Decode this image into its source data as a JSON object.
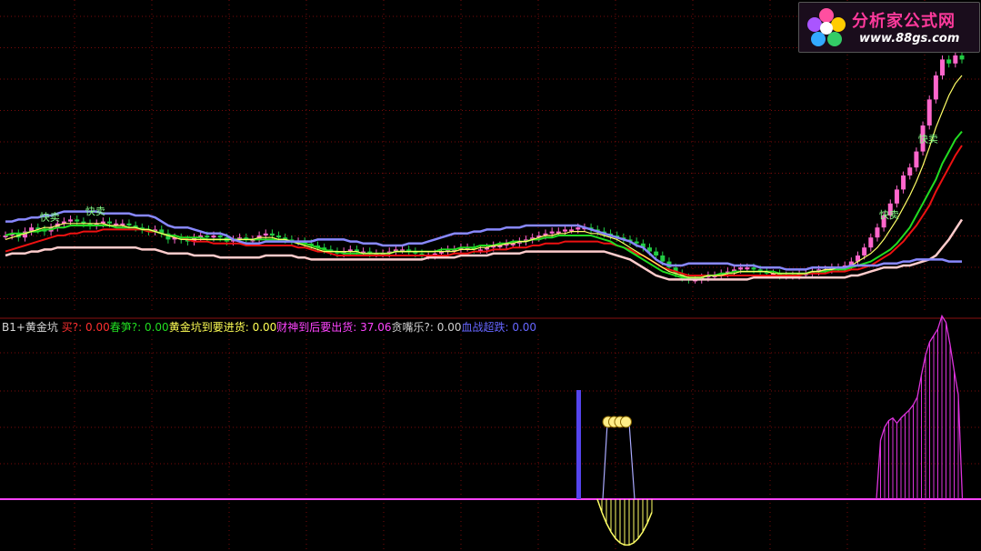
{
  "logo": {
    "text_cn": "分析家公式网",
    "url": "www.88gs.com",
    "icon": "flower-icon",
    "text_color": "#ff3a9c"
  },
  "indicator_header": {
    "name": "B1+黄金坑",
    "items": [
      {
        "label": "买?:",
        "value": "0.00",
        "color": "#ff3030"
      },
      {
        "label": "春笋?:",
        "value": "0.00",
        "color": "#22dd22"
      },
      {
        "label": "黄金坑到要进货:",
        "value": "0.00",
        "color": "#ffff55"
      },
      {
        "label": "财神到后要出货:",
        "value": "37.06",
        "color": "#ff44ff"
      },
      {
        "label": "贪嘴乐?:",
        "value": "0.00",
        "color": "#d0d0d0"
      },
      {
        "label": "血战超跌:",
        "value": "0.00",
        "color": "#6666ff"
      }
    ]
  },
  "annotations": [
    {
      "text": "快卖",
      "at": 12,
      "color": "#88ff88"
    },
    {
      "text": "快卖",
      "at": 28,
      "color": "#88ff88"
    },
    {
      "text": "快卖",
      "at": 315,
      "color": "#88ff88"
    },
    {
      "text": "快卖",
      "at": 328,
      "color": "#88ff88"
    }
  ],
  "chart_data": {
    "type": "line",
    "main_panel": {
      "price": [
        30,
        31,
        29,
        32,
        34,
        33,
        32,
        34,
        36,
        37,
        38,
        37,
        36,
        35,
        36,
        37,
        36,
        36,
        36,
        35,
        34,
        33,
        32,
        33,
        31,
        28,
        29,
        28,
        27,
        29,
        30,
        29,
        30,
        29,
        27,
        28,
        29,
        28,
        28,
        30,
        31,
        30,
        29,
        28,
        27,
        27,
        26,
        25,
        24,
        23,
        22,
        21,
        22,
        23,
        22,
        22,
        21,
        21,
        21,
        22,
        23,
        23,
        22,
        21,
        20,
        20,
        21,
        22,
        23,
        23,
        24,
        24,
        23,
        23,
        24,
        25,
        25,
        26,
        26,
        27,
        28,
        29,
        30,
        31,
        32,
        32,
        33,
        33,
        34,
        34,
        33,
        32,
        31,
        30,
        29,
        28,
        27,
        26,
        24,
        22,
        20,
        17,
        14,
        11,
        9,
        8,
        8,
        9,
        10,
        10,
        11,
        12,
        13,
        14,
        14,
        13,
        12,
        11,
        11,
        10,
        10,
        10,
        11,
        11,
        12,
        13,
        13,
        14,
        14,
        15,
        17,
        20,
        24,
        29,
        34,
        40,
        46,
        53,
        60,
        64,
        72,
        85,
        98,
        110,
        118,
        116,
        120,
        118
      ],
      "upper_band": [
        37,
        37,
        38,
        38,
        39,
        39,
        40,
        40,
        41,
        42,
        42,
        42,
        42,
        42,
        42,
        41,
        41,
        41,
        41,
        41,
        40,
        40,
        40,
        39,
        37,
        35,
        34,
        34,
        34,
        33,
        32,
        31,
        31,
        31,
        30,
        28,
        27,
        26,
        26,
        26,
        27,
        27,
        27,
        27,
        27,
        27,
        27,
        27,
        28,
        28,
        28,
        28,
        28,
        27,
        27,
        26,
        26,
        26,
        25,
        25,
        25,
        25,
        26,
        26,
        26,
        27,
        28,
        29,
        30,
        31,
        31,
        31,
        32,
        32,
        33,
        33,
        33,
        34,
        34,
        34,
        35,
        35,
        35,
        35,
        35,
        35,
        35,
        35,
        35,
        34,
        33,
        32,
        31,
        30,
        29,
        28,
        27,
        25,
        24,
        21,
        18,
        16,
        15,
        15,
        15,
        16,
        16,
        16,
        16,
        16,
        16,
        16,
        15,
        15,
        15,
        15,
        14,
        14,
        14,
        14,
        13,
        13,
        13,
        13,
        14,
        14,
        14,
        14,
        14,
        14,
        15,
        15,
        15,
        15,
        15,
        16,
        16,
        16,
        17,
        17,
        18,
        18,
        18,
        18,
        18,
        17,
        17,
        17
      ],
      "ma_green": [
        30,
        31,
        31,
        31,
        32,
        32,
        33,
        33,
        34,
        34,
        35,
        35,
        35,
        35,
        35,
        35,
        35,
        34,
        34,
        34,
        34,
        33,
        33,
        32,
        31,
        30,
        30,
        29,
        29,
        29,
        29,
        28,
        28,
        28,
        28,
        28,
        28,
        28,
        28,
        28,
        28,
        28,
        28,
        28,
        27,
        26,
        26,
        25,
        24,
        23,
        22,
        22,
        21,
        21,
        21,
        21,
        21,
        21,
        21,
        21,
        22,
        22,
        22,
        22,
        22,
        22,
        22,
        23,
        23,
        23,
        24,
        24,
        24,
        25,
        25,
        25,
        26,
        26,
        27,
        27,
        27,
        28,
        28,
        29,
        29,
        30,
        30,
        30,
        30,
        30,
        30,
        29,
        28,
        27,
        25,
        24,
        22,
        20,
        18,
        16,
        14,
        12,
        11,
        10,
        9,
        9,
        9,
        9,
        10,
        10,
        11,
        11,
        12,
        12,
        12,
        12,
        12,
        12,
        12,
        11,
        11,
        11,
        11,
        11,
        12,
        12,
        12,
        13,
        13,
        13,
        14,
        15,
        16,
        17,
        19,
        21,
        23,
        26,
        30,
        34,
        40,
        46,
        52,
        58,
        66,
        72,
        78,
        82
      ],
      "ma_red": [
        22,
        23,
        24,
        25,
        26,
        27,
        28,
        29,
        30,
        30,
        31,
        31,
        32,
        32,
        32,
        33,
        33,
        33,
        33,
        33,
        33,
        33,
        32,
        32,
        31,
        30,
        30,
        29,
        28,
        27,
        27,
        27,
        26,
        26,
        26,
        26,
        26,
        25,
        25,
        25,
        25,
        25,
        25,
        25,
        25,
        24,
        24,
        23,
        22,
        22,
        21,
        20,
        20,
        20,
        20,
        20,
        20,
        20,
        20,
        20,
        20,
        20,
        20,
        20,
        20,
        20,
        20,
        20,
        20,
        21,
        21,
        21,
        22,
        22,
        22,
        23,
        23,
        23,
        24,
        24,
        24,
        25,
        25,
        26,
        26,
        26,
        27,
        27,
        27,
        27,
        27,
        27,
        26,
        26,
        25,
        24,
        23,
        21,
        20,
        18,
        16,
        14,
        13,
        12,
        11,
        10,
        10,
        10,
        10,
        10,
        10,
        10,
        10,
        10,
        10,
        10,
        10,
        10,
        10,
        10,
        10,
        10,
        10,
        11,
        11,
        11,
        11,
        12,
        12,
        12,
        13,
        13,
        14,
        15,
        17,
        19,
        21,
        24,
        27,
        31,
        35,
        40,
        45,
        52,
        58,
        64,
        70,
        75
      ],
      "ma_yellow": [
        28,
        29,
        30,
        31,
        32,
        33,
        34,
        34,
        35,
        36,
        36,
        36,
        36,
        36,
        36,
        36,
        35,
        35,
        35,
        34,
        34,
        33,
        33,
        32,
        31,
        30,
        29,
        28,
        28,
        28,
        28,
        28,
        28,
        28,
        28,
        28,
        28,
        28,
        28,
        29,
        29,
        29,
        28,
        28,
        27,
        26,
        25,
        24,
        23,
        22,
        22,
        22,
        22,
        22,
        22,
        21,
        21,
        21,
        21,
        21,
        22,
        22,
        22,
        22,
        22,
        22,
        22,
        22,
        22,
        22,
        23,
        23,
        23,
        24,
        24,
        25,
        25,
        26,
        26,
        27,
        27,
        28,
        29,
        30,
        30,
        31,
        31,
        32,
        32,
        32,
        31,
        31,
        30,
        29,
        28,
        26,
        24,
        22,
        20,
        18,
        16,
        14,
        12,
        11,
        10,
        9,
        9,
        9,
        10,
        10,
        10,
        11,
        11,
        12,
        12,
        12,
        12,
        12,
        11,
        11,
        11,
        11,
        11,
        11,
        12,
        12,
        13,
        13,
        14,
        14,
        15,
        17,
        19,
        21,
        24,
        28,
        33,
        38,
        44,
        50,
        57,
        65,
        74,
        84,
        92,
        100,
        106,
        110
      ],
      "lower_band": [
        20,
        21,
        21,
        21,
        22,
        22,
        23,
        23,
        24,
        24,
        24,
        24,
        24,
        24,
        24,
        24,
        24,
        24,
        24,
        24,
        24,
        23,
        23,
        23,
        22,
        21,
        21,
        21,
        21,
        20,
        20,
        20,
        20,
        19,
        19,
        19,
        19,
        19,
        19,
        19,
        20,
        20,
        20,
        20,
        20,
        19,
        19,
        18,
        18,
        18,
        18,
        18,
        18,
        18,
        18,
        18,
        18,
        18,
        18,
        18,
        18,
        18,
        18,
        18,
        18,
        19,
        19,
        19,
        19,
        19,
        20,
        20,
        20,
        20,
        20,
        21,
        21,
        21,
        21,
        21,
        22,
        22,
        22,
        22,
        22,
        22,
        22,
        22,
        22,
        22,
        22,
        22,
        22,
        21,
        20,
        19,
        18,
        16,
        14,
        12,
        10,
        9,
        8,
        8,
        8,
        8,
        8,
        8,
        8,
        8,
        8,
        8,
        8,
        8,
        8,
        9,
        9,
        9,
        9,
        9,
        9,
        9,
        9,
        9,
        9,
        9,
        9,
        9,
        9,
        9,
        10,
        10,
        11,
        12,
        13,
        14,
        14,
        14,
        15,
        15,
        16,
        17,
        18,
        20,
        24,
        28,
        33,
        38
      ]
    },
    "sub_panel": {
      "baseline": 0,
      "blue_bar": {
        "index": 106,
        "value": 100
      },
      "yellow_triangle_peak": {
        "index": 111,
        "value": 70
      },
      "yellow_negative": [
        0,
        -12,
        -22,
        -30,
        -36,
        -40,
        -42,
        -42,
        -40,
        -36,
        -30,
        -22,
        -12
      ],
      "magenta_positive": [
        0,
        45,
        55,
        60,
        62,
        58,
        62,
        65,
        68,
        72,
        78,
        95,
        110,
        120,
        125,
        130,
        140,
        135,
        118,
        98,
        80,
        0
      ]
    }
  }
}
